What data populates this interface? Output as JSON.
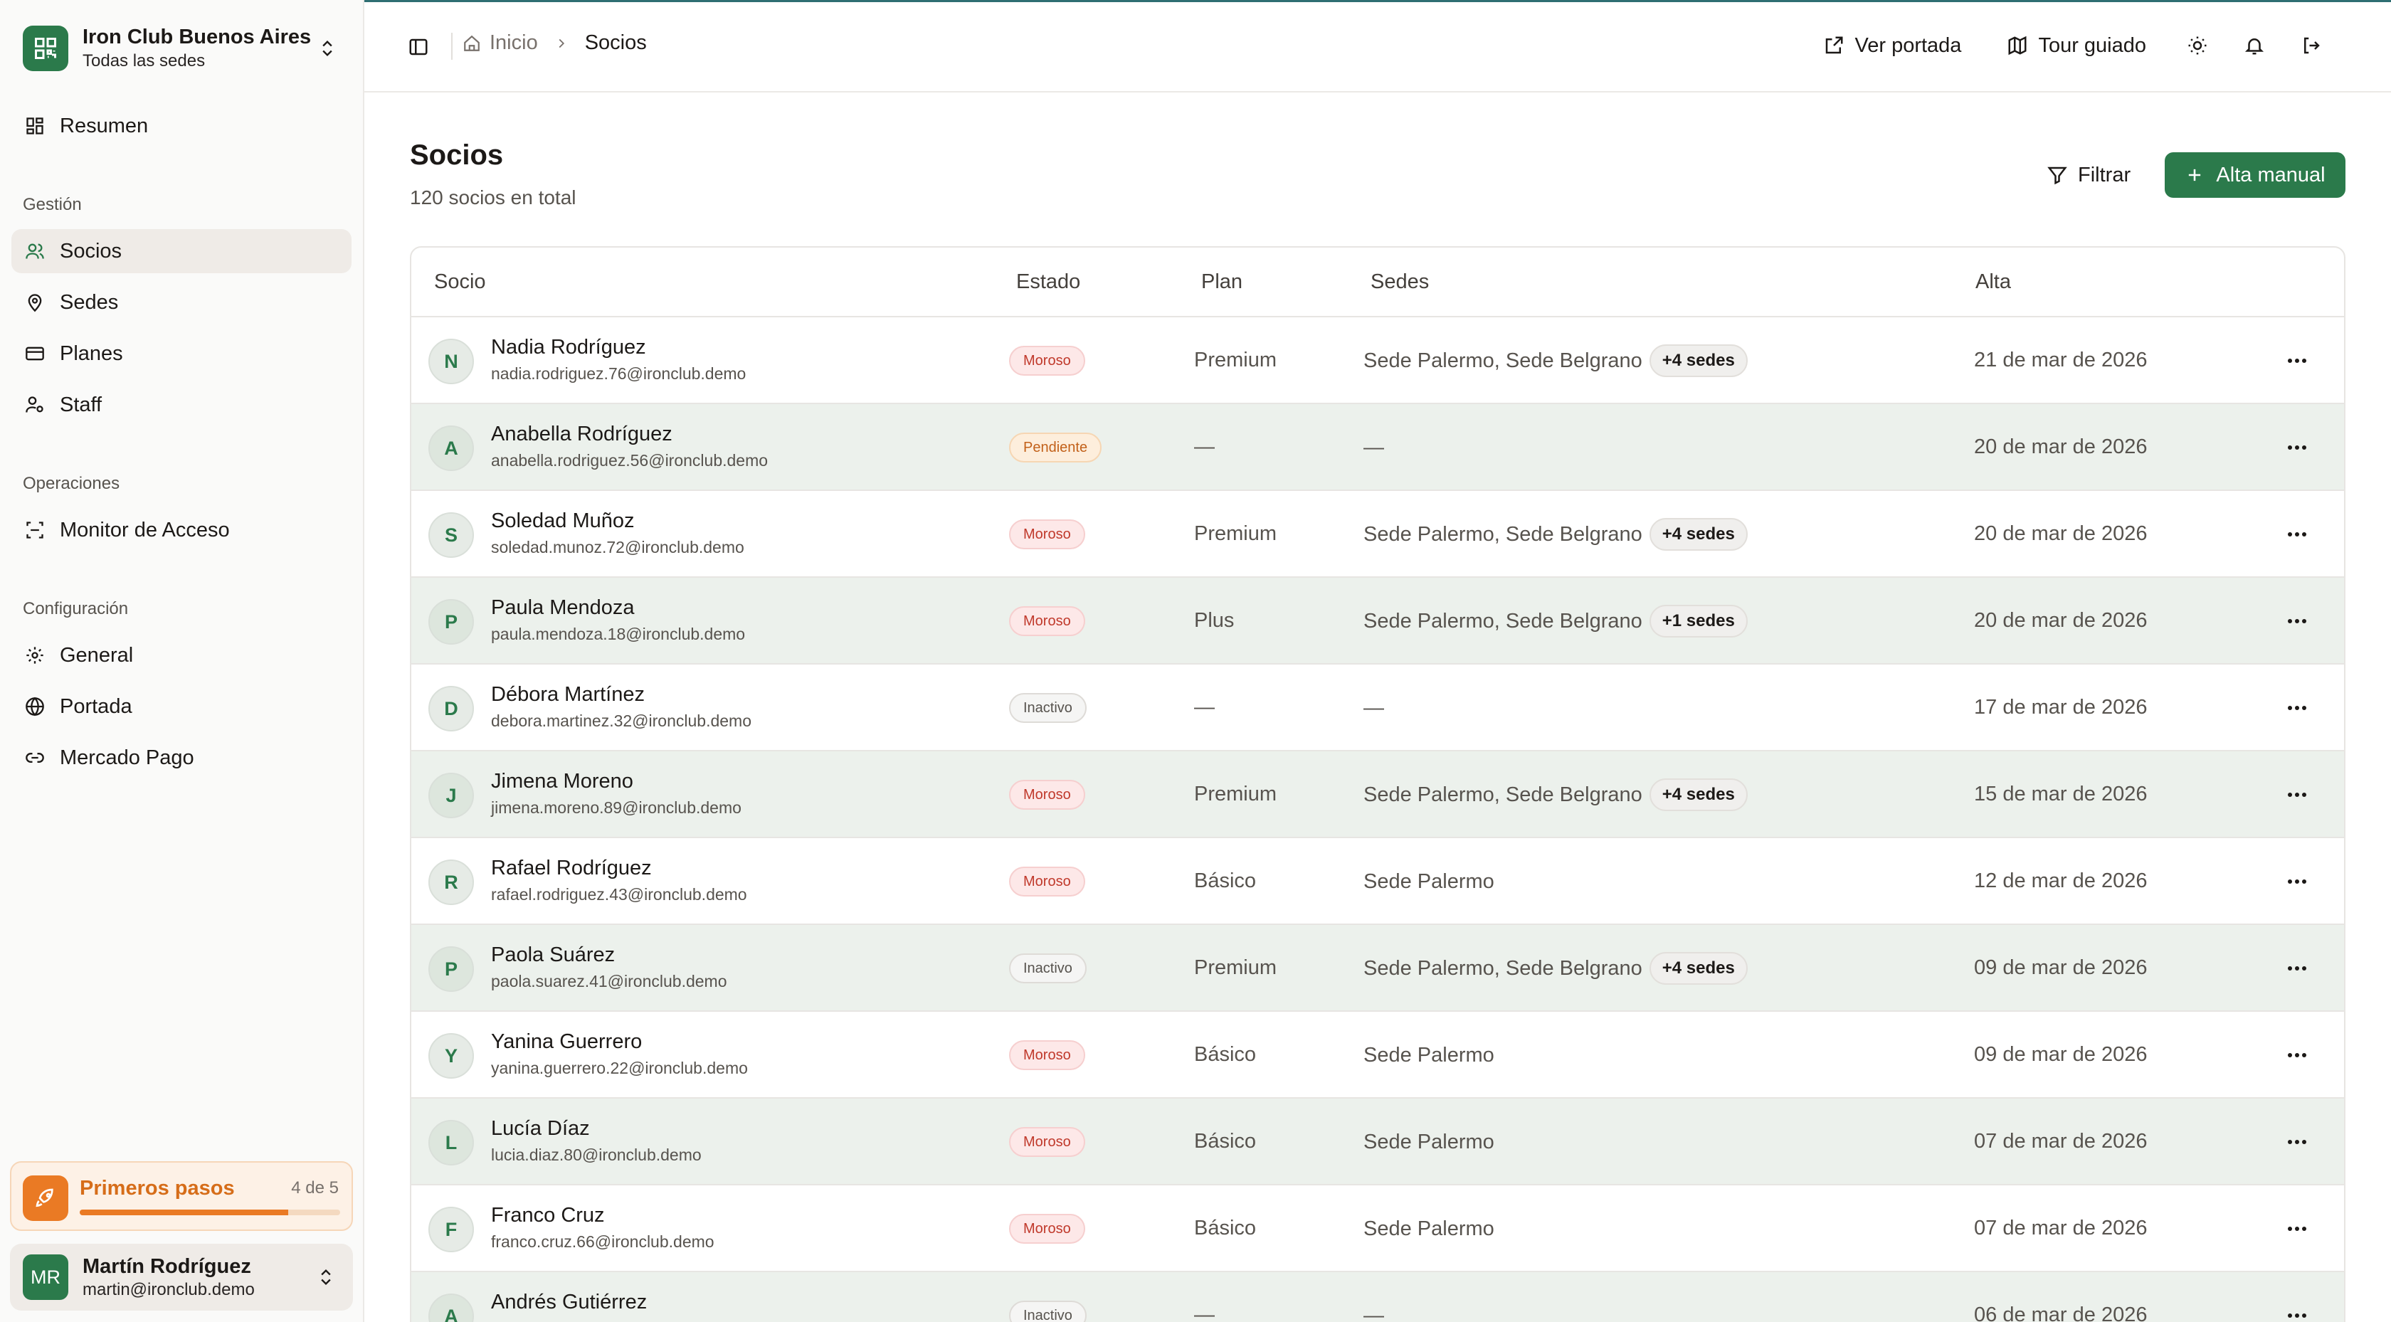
{
  "org": {
    "name": "Iron Club Buenos Aires",
    "subtitle": "Todas las sedes"
  },
  "sidebar": {
    "summary": "Resumen",
    "sections": [
      {
        "title": "Gestión",
        "items": [
          "Socios",
          "Sedes",
          "Planes",
          "Staff"
        ]
      },
      {
        "title": "Operaciones",
        "items": [
          "Monitor de Acceso"
        ]
      },
      {
        "title": "Configuración",
        "items": [
          "General",
          "Portada",
          "Mercado Pago"
        ]
      }
    ],
    "active_item": "Socios"
  },
  "onboarding": {
    "title": "Primeros pasos",
    "count": "4 de 5",
    "progress": 0.8
  },
  "user": {
    "initials": "MR",
    "name": "Martín Rodríguez",
    "email": "martin@ironclub.demo"
  },
  "breadcrumb": [
    "Inicio",
    "Socios"
  ],
  "header_actions": {
    "view_cover": "Ver portada",
    "tour": "Tour guiado"
  },
  "page": {
    "title": "Socios",
    "subtitle": "120 socios en total",
    "filter_label": "Filtrar",
    "add_label": "Alta manual"
  },
  "table": {
    "columns": [
      "Socio",
      "Estado",
      "Plan",
      "Sedes",
      "Alta"
    ],
    "rows": [
      {
        "initial": "N",
        "name": "Nadia Rodríguez",
        "email": "nadia.rodriguez.76@ironclub.demo",
        "status": "Moroso",
        "status_kind": "moroso",
        "plan": "Premium",
        "sedes": "Sede Palermo, Sede Belgrano",
        "extra": "+4 sedes",
        "alta": "21 de mar de 2026"
      },
      {
        "initial": "A",
        "name": "Anabella Rodríguez",
        "email": "anabella.rodriguez.56@ironclub.demo",
        "status": "Pendiente",
        "status_kind": "pendiente",
        "plan": "—",
        "sedes": "—",
        "extra": "",
        "alta": "20 de mar de 2026"
      },
      {
        "initial": "S",
        "name": "Soledad Muñoz",
        "email": "soledad.munoz.72@ironclub.demo",
        "status": "Moroso",
        "status_kind": "moroso",
        "plan": "Premium",
        "sedes": "Sede Palermo, Sede Belgrano",
        "extra": "+4 sedes",
        "alta": "20 de mar de 2026"
      },
      {
        "initial": "P",
        "name": "Paula Mendoza",
        "email": "paula.mendoza.18@ironclub.demo",
        "status": "Moroso",
        "status_kind": "moroso",
        "plan": "Plus",
        "sedes": "Sede Palermo, Sede Belgrano",
        "extra": "+1 sedes",
        "alta": "20 de mar de 2026"
      },
      {
        "initial": "D",
        "name": "Débora Martínez",
        "email": "debora.martinez.32@ironclub.demo",
        "status": "Inactivo",
        "status_kind": "inactivo",
        "plan": "—",
        "sedes": "—",
        "extra": "",
        "alta": "17 de mar de 2026"
      },
      {
        "initial": "J",
        "name": "Jimena Moreno",
        "email": "jimena.moreno.89@ironclub.demo",
        "status": "Moroso",
        "status_kind": "moroso",
        "plan": "Premium",
        "sedes": "Sede Palermo, Sede Belgrano",
        "extra": "+4 sedes",
        "alta": "15 de mar de 2026"
      },
      {
        "initial": "R",
        "name": "Rafael Rodríguez",
        "email": "rafael.rodriguez.43@ironclub.demo",
        "status": "Moroso",
        "status_kind": "moroso",
        "plan": "Básico",
        "sedes": "Sede Palermo",
        "extra": "",
        "alta": "12 de mar de 2026"
      },
      {
        "initial": "P",
        "name": "Paola Suárez",
        "email": "paola.suarez.41@ironclub.demo",
        "status": "Inactivo",
        "status_kind": "inactivo",
        "plan": "Premium",
        "sedes": "Sede Palermo, Sede Belgrano",
        "extra": "+4 sedes",
        "alta": "09 de mar de 2026"
      },
      {
        "initial": "Y",
        "name": "Yanina Guerrero",
        "email": "yanina.guerrero.22@ironclub.demo",
        "status": "Moroso",
        "status_kind": "moroso",
        "plan": "Básico",
        "sedes": "Sede Palermo",
        "extra": "",
        "alta": "09 de mar de 2026"
      },
      {
        "initial": "L",
        "name": "Lucía Díaz",
        "email": "lucia.diaz.80@ironclub.demo",
        "status": "Moroso",
        "status_kind": "moroso",
        "plan": "Básico",
        "sedes": "Sede Palermo",
        "extra": "",
        "alta": "07 de mar de 2026"
      },
      {
        "initial": "F",
        "name": "Franco Cruz",
        "email": "franco.cruz.66@ironclub.demo",
        "status": "Moroso",
        "status_kind": "moroso",
        "plan": "Básico",
        "sedes": "Sede Palermo",
        "extra": "",
        "alta": "07 de mar de 2026"
      },
      {
        "initial": "A",
        "name": "Andrés Gutiérrez",
        "email": "",
        "status": "Inactivo",
        "status_kind": "inactivo",
        "plan": "—",
        "sedes": "—",
        "extra": "",
        "alta": "06 de mar de 2026"
      }
    ]
  },
  "colors": {
    "brand": "#2b7a4b",
    "accent_orange": "#ea7a24",
    "row_alt": "#ecf1ec"
  },
  "icons": [
    "qr-code-icon",
    "chevrons-up-down-icon",
    "grid-icon",
    "users-icon",
    "map-pin-icon",
    "credit-card-icon",
    "user-cog-icon",
    "scan-icon",
    "gear-icon",
    "globe-icon",
    "link-icon",
    "rocket-icon",
    "sidebar-toggle-icon",
    "home-icon",
    "chevron-right-icon",
    "external-link-icon",
    "map-icon",
    "sun-icon",
    "bell-icon",
    "logout-icon",
    "filter-icon",
    "plus-icon",
    "more-horizontal-icon"
  ]
}
